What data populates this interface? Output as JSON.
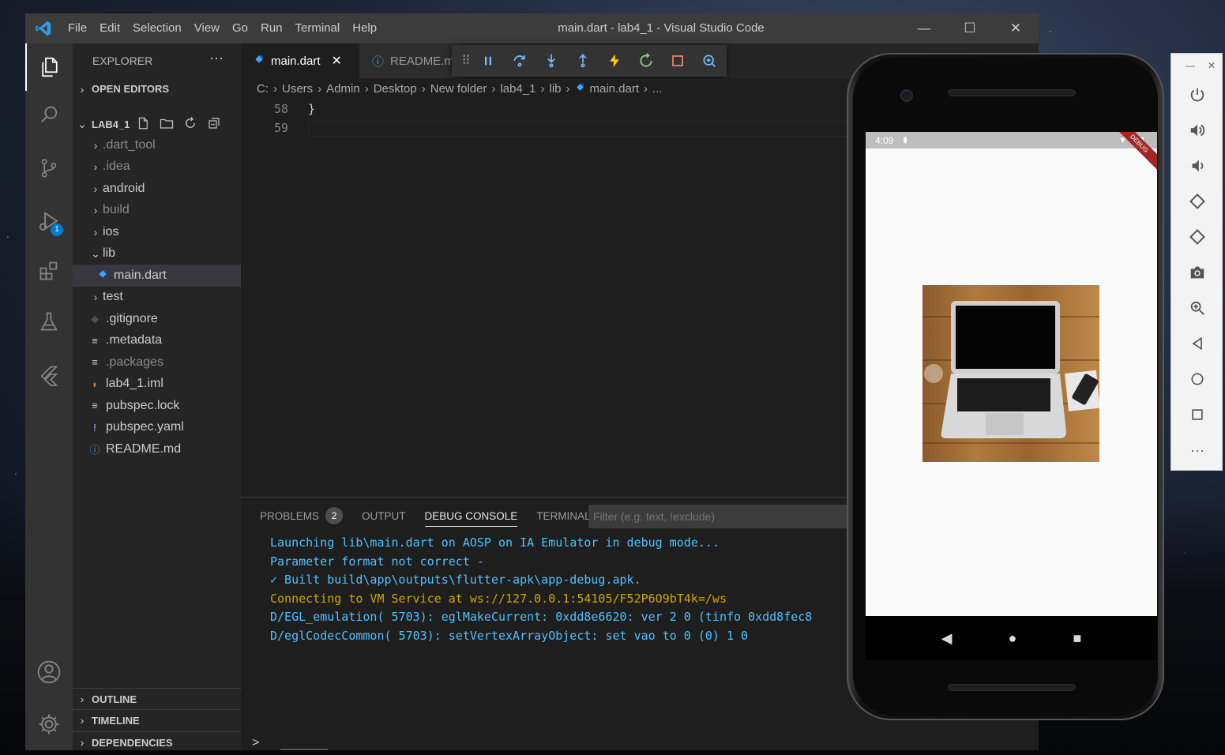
{
  "window": {
    "title": "main.dart - lab4_1 - Visual Studio Code",
    "menu": [
      "File",
      "Edit",
      "Selection",
      "View",
      "Go",
      "Run",
      "Terminal",
      "Help"
    ]
  },
  "activity": {
    "debug_badge": "1"
  },
  "explorer": {
    "title": "EXPLORER",
    "more": "···",
    "open_editors": "OPEN EDITORS",
    "project": "LAB4_1",
    "tree": [
      {
        "label": ".dart_tool",
        "type": "folder"
      },
      {
        "label": ".idea",
        "type": "folder"
      },
      {
        "label": "android",
        "type": "folder"
      },
      {
        "label": "build",
        "type": "folder"
      },
      {
        "label": "ios",
        "type": "folder"
      },
      {
        "label": "lib",
        "type": "folder-open"
      },
      {
        "label": "main.dart",
        "type": "dart"
      },
      {
        "label": "test",
        "type": "folder"
      },
      {
        "label": ".gitignore",
        "type": "git"
      },
      {
        "label": ".metadata",
        "type": "lines"
      },
      {
        "label": ".packages",
        "type": "lines"
      },
      {
        "label": "lab4_1.iml",
        "type": "rss"
      },
      {
        "label": "pubspec.lock",
        "type": "lines"
      },
      {
        "label": "pubspec.yaml",
        "type": "excl"
      },
      {
        "label": "README.md",
        "type": "info"
      }
    ],
    "outline": "OUTLINE",
    "timeline": "TIMELINE",
    "dependencies": "DEPENDENCIES"
  },
  "tabs": [
    {
      "label": "main.dart",
      "active": true
    },
    {
      "label": "README.md",
      "active": false
    }
  ],
  "breadcrumb": [
    "C:",
    "Users",
    "Admin",
    "Desktop",
    "New folder",
    "lab4_1",
    "lib",
    "main.dart",
    "..."
  ],
  "editor": {
    "lines": [
      {
        "num": "58",
        "text": "}"
      },
      {
        "num": "59",
        "text": ""
      }
    ]
  },
  "panel": {
    "tabs": [
      "PROBLEMS",
      "OUTPUT",
      "DEBUG CONSOLE",
      "TERMINAL"
    ],
    "problems_count": "2",
    "filter_placeholder": "Filter (e.g. text, !exclude)",
    "console": [
      {
        "text": "Launching lib\\main.dart on AOSP on IA Emulator in debug mode...",
        "color": "#4fc1ff"
      },
      {
        "text": "Parameter format not correct -",
        "color": "#4fc1ff"
      },
      {
        "text": "✓ Built build\\app\\outputs\\flutter-apk\\app-debug.apk.",
        "color": "#4fc1ff"
      },
      {
        "text": "Connecting to VM Service at ws://127.0.0.1:54105/F52P6O9bT4k=/ws",
        "color": "#cca700"
      },
      {
        "text": "D/EGL_emulation( 5703): eglMakeCurrent: 0xdd8e6620: ver 2 0 (tinfo 0xdd8fec8",
        "color": "#4fc1ff"
      },
      {
        "text": "D/eglCodecCommon( 5703): setVertexArrayObject: set vao to 0 (0) 1 0",
        "color": "#4fc1ff"
      }
    ],
    "prompt": ">"
  },
  "emulator": {
    "time": "4:09",
    "debug_ribbon": "DEBUG",
    "nav": [
      "◀",
      "●",
      "■"
    ]
  },
  "colors": {
    "accent": "#007acc",
    "titlebar": "#3c3c3c",
    "activitybar": "#333333",
    "sidebar": "#252526",
    "editor": "#1e1e1e"
  }
}
